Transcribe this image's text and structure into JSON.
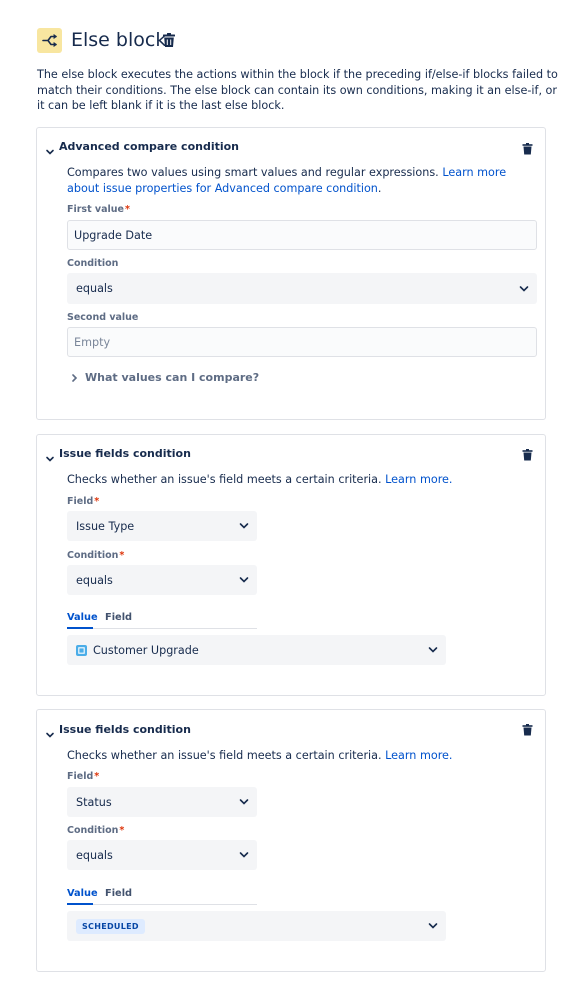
{
  "header": {
    "title": "Else block",
    "description": "The else block executes the actions within the block if the preceding if/else-if blocks failed to match their conditions. The else block can contain its own conditions, making it an else-if, or it can be left blank if it is the last else block."
  },
  "card1": {
    "title": "Advanced compare condition",
    "desc_text": "Compares two values using smart values and regular expressions.",
    "desc_link": "Learn more about issue properties for Advanced compare condition",
    "desc_end": ".",
    "first_value_label": "First value",
    "first_value": "Upgrade Date",
    "condition_label": "Condition",
    "condition_value": "equals",
    "second_value_label": "Second value",
    "second_value_placeholder": "Empty",
    "expander_label": "What values can I compare?"
  },
  "card2": {
    "title": "Issue fields condition",
    "desc_text": "Checks whether an issue's field meets a certain criteria.",
    "desc_link": "Learn more.",
    "field_label": "Field",
    "field_value": "Issue Type",
    "condition_label": "Condition",
    "condition_value": "equals",
    "tab_value": "Value",
    "tab_field": "Field",
    "value": "Customer Upgrade"
  },
  "card3": {
    "title": "Issue fields condition",
    "desc_text": "Checks whether an issue's field meets a certain criteria.",
    "desc_link": "Learn more.",
    "field_label": "Field",
    "field_value": "Status",
    "condition_label": "Condition",
    "condition_value": "equals",
    "tab_value": "Value",
    "tab_field": "Field",
    "value": "SCHEDULED"
  },
  "required_marker": "*",
  "colors": {
    "link": "#0052cc",
    "required": "#de350b",
    "header_icon_bg": "#f8e6a0",
    "lozenge_bg": "#deebff"
  },
  "icons": {
    "header": "branch-icon",
    "delete": "trash-icon",
    "collapse": "chevron-down-icon",
    "expand": "chevron-right-icon",
    "issue_type": "issue-type-icon"
  }
}
